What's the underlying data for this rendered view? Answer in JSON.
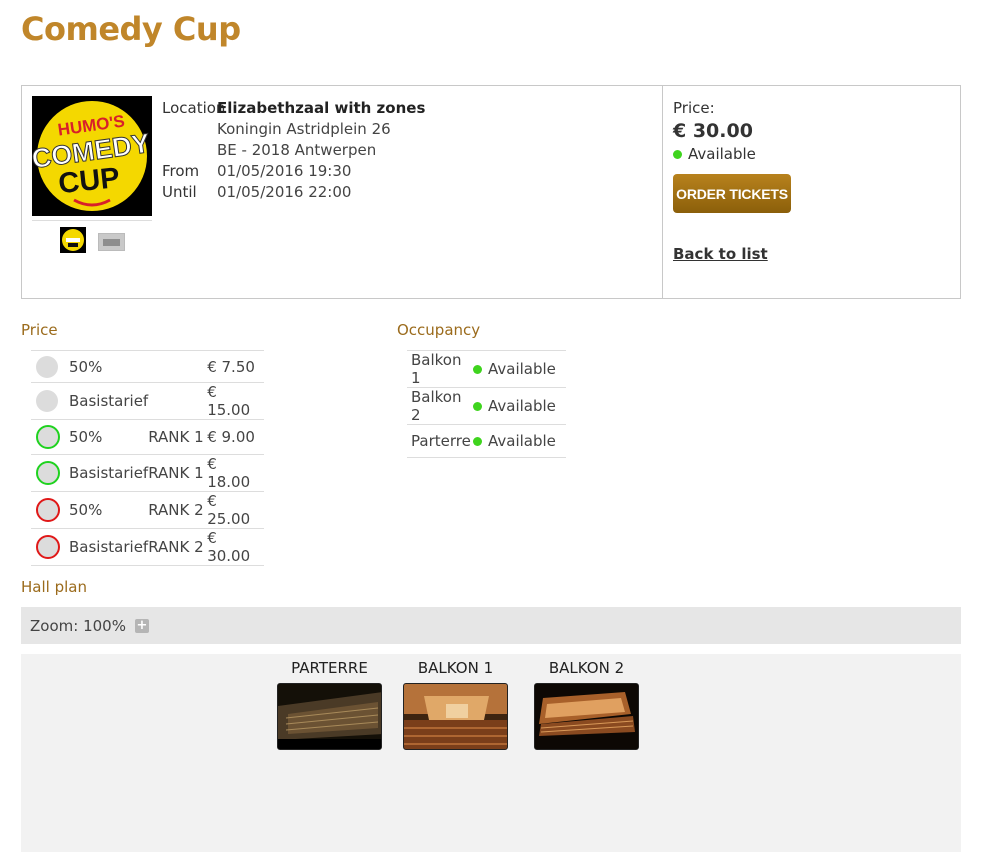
{
  "page": {
    "title": "Comedy Cup"
  },
  "poster": {
    "text_line1": "HUMO'S",
    "text_line2": "COMEDY",
    "text_line3": "CUP",
    "colors": {
      "background": "#000000",
      "disc": "#f4d800",
      "text": "#d8202a"
    }
  },
  "event": {
    "location_label": "Location",
    "venue": "Elizabethzaal with zones",
    "address_line1": "Koningin Astridplein 26",
    "address_line2": "BE - 2018 Antwerpen",
    "from_label": "From",
    "from_value": "01/05/2016 19:30",
    "until_label": "Until",
    "until_value": "01/05/2016 22:00"
  },
  "sidebar": {
    "price_label": "Price:",
    "price_value": "€ 30.00",
    "availability": "Available",
    "order_button": "ORDER TICKETS",
    "back_link": "Back to list"
  },
  "prices": {
    "title": "Price",
    "rows": [
      {
        "indicator": "grey",
        "name": "50%",
        "rank": "",
        "price": "€ 7.50"
      },
      {
        "indicator": "grey",
        "name": "Basistarief",
        "rank": "",
        "price": "€ 15.00"
      },
      {
        "indicator": "green",
        "name": "50%",
        "rank": "RANK 1",
        "price": "€ 9.00"
      },
      {
        "indicator": "green",
        "name": "Basistarief",
        "rank": "RANK 1",
        "price": "€ 18.00"
      },
      {
        "indicator": "red",
        "name": "50%",
        "rank": "RANK 2",
        "price": "€ 25.00"
      },
      {
        "indicator": "red",
        "name": "Basistarief",
        "rank": "RANK 2",
        "price": "€ 30.00"
      }
    ]
  },
  "occupancy": {
    "title": "Occupancy",
    "rows": [
      {
        "zone": "Balkon 1",
        "status": "Available"
      },
      {
        "zone": "Balkon 2",
        "status": "Available"
      },
      {
        "zone": "Parterre",
        "status": "Available"
      }
    ]
  },
  "hall_plan": {
    "title": "Hall plan",
    "zoom_text": "Zoom: 100%",
    "zoom_plus": "+",
    "zones": [
      {
        "label": "PARTERRE"
      },
      {
        "label": "BALKON 1"
      },
      {
        "label": "BALKON 2"
      }
    ]
  },
  "colors": {
    "accent": "#c0862a",
    "available": "#3fd41e",
    "rank1": "#1fd21f",
    "rank2": "#e01818"
  }
}
